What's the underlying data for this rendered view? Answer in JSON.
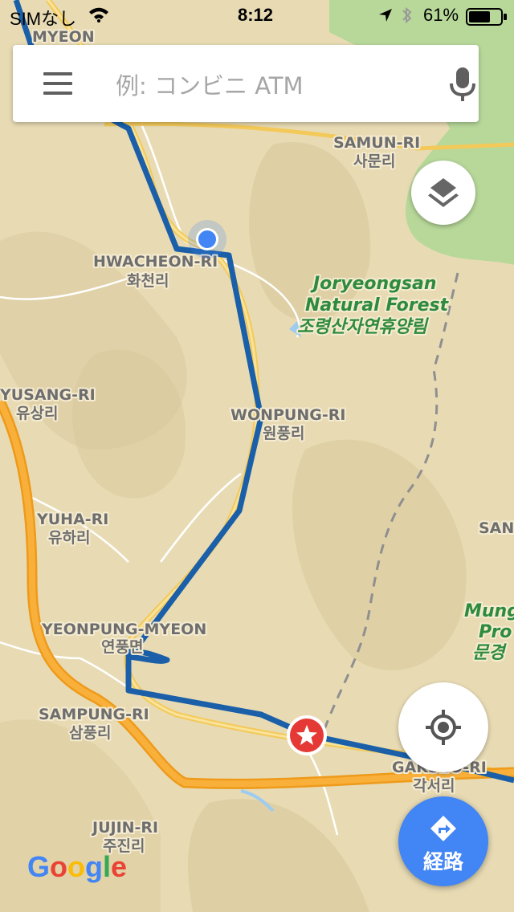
{
  "status_bar": {
    "carrier": "SIMなし",
    "time": "8:12",
    "battery": "61%"
  },
  "search": {
    "placeholder": "例: コンビニ ATM"
  },
  "map_labels": {
    "samun_en": "SAMUN-RI",
    "samun_ko": "사문리",
    "hwacheon_en": "HWACHEON-RI",
    "hwacheon_ko": "화천리",
    "joryeong_1": "Joryeongsan",
    "joryeong_2": "Natural Forest",
    "joryeong_ko": "조령산자연휴양림",
    "yusang_en": "YUSANG-RI",
    "yusang_ko": "유상리",
    "wonpung_en": "WONPUNG-RI",
    "wonpung_ko": "원풍리",
    "yuha_en": "YUHA-RI",
    "yuha_ko": "유하리",
    "yeonpung_en": "YEONPUNG-MYEON",
    "yeonpung_ko": "연풍면",
    "sampung_en": "SAMPUNG-RI",
    "sampung_ko": "삼풍리",
    "gakseo_en": "GAKSEO-RI",
    "gakseo_ko": "각서리",
    "jujin_en": "JUJIN-RI",
    "jujin_ko": "주진리",
    "san_en": "SAN",
    "mung_1": "Mung",
    "mung_2": "Pro",
    "mung_ko": "문경",
    "top_left": "MYEON"
  },
  "google_logo": "Google",
  "directions_button": {
    "label": "経路"
  },
  "colors": {
    "route": "#1a5fa8",
    "highway": "#f7a21b",
    "my_location": "#4285f4",
    "destination": "#e53935",
    "directions_fab": "#4285f4",
    "park": "#b8d89a"
  }
}
